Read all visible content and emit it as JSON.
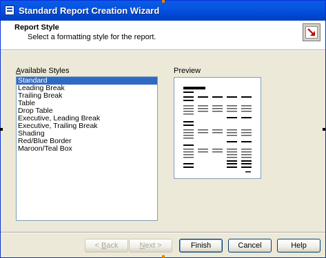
{
  "window": {
    "title": "Standard Report Creation Wizard"
  },
  "header": {
    "title": "Report Style",
    "subtitle": "Select a formatting style for the report.",
    "icon": "report-wizard-icon"
  },
  "styles": {
    "label_accel": "A",
    "label_rest": "vailable Styles",
    "items": [
      "Standard",
      "Leading Break",
      "Trailing Break",
      "Table",
      "Drop Table",
      "Executive, Leading Break",
      "Executive, Trailing Break",
      "Shading",
      "Red/Blue Border",
      "Maroon/Teal Box"
    ],
    "selected": "Standard"
  },
  "preview": {
    "label": "Preview"
  },
  "buttons": {
    "back": {
      "prefix": "< ",
      "accel": "B",
      "rest": "ack"
    },
    "next": {
      "accel": "N",
      "rest": "ext >"
    },
    "finish": "Finish",
    "cancel": "Cancel",
    "help": "Help"
  },
  "colors": {
    "titlebar": "#0054e3",
    "selection": "#316ac5",
    "dialog": "#ece9d8"
  }
}
